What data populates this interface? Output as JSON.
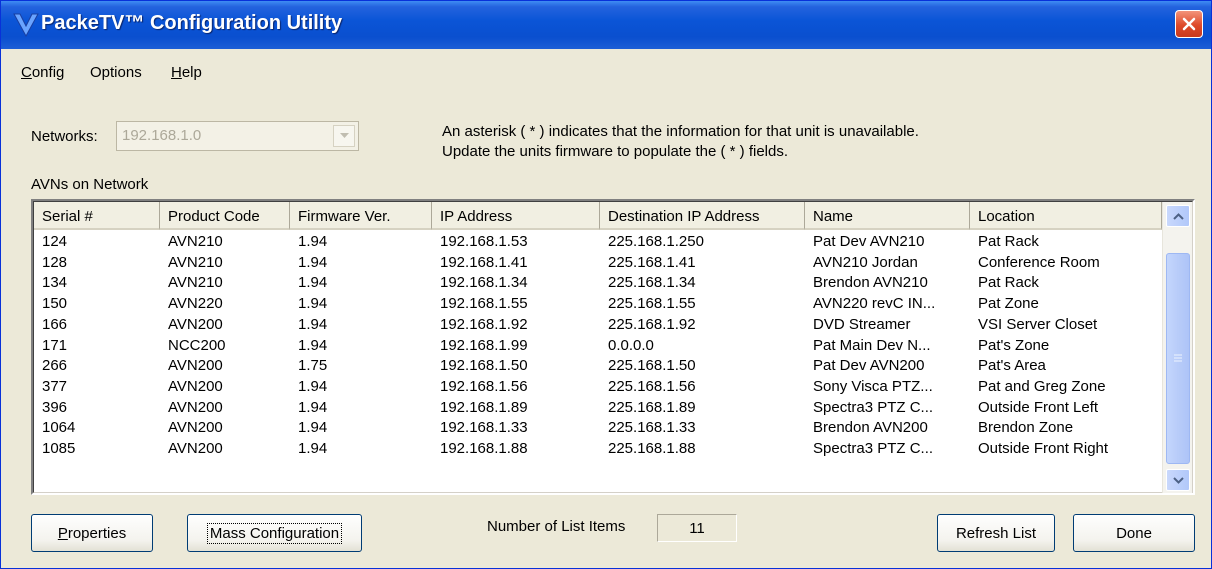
{
  "window": {
    "title": "PackeTV™ Configuration Utility"
  },
  "menu": [
    {
      "label": "Config",
      "accel": "C",
      "rest": "onfig"
    },
    {
      "label": "Options",
      "accel": "",
      "rest": "Options"
    },
    {
      "label": "Help",
      "accel": "H",
      "rest": "elp"
    }
  ],
  "networks": {
    "label": "Networks:",
    "value": "192.168.1.0"
  },
  "notice": {
    "line1": "An asterisk ( * ) indicates that the information for that unit is unavailable.",
    "line2": "Update the units firmware to populate the ( * ) fields."
  },
  "list": {
    "caption": "AVNs on Network",
    "columns": [
      "Serial #",
      "Product Code",
      "Firmware Ver.",
      "IP Address",
      "Destination IP Address",
      "Name",
      "Location"
    ],
    "rows": [
      [
        "124",
        "AVN210",
        "1.94",
        "192.168.1.53",
        "225.168.1.250",
        "Pat Dev AVN210",
        "Pat Rack"
      ],
      [
        "128",
        "AVN210",
        "1.94",
        "192.168.1.41",
        "225.168.1.41",
        "AVN210 Jordan",
        "Conference Room"
      ],
      [
        "134",
        "AVN210",
        "1.94",
        "192.168.1.34",
        "225.168.1.34",
        "Brendon AVN210",
        "Pat Rack"
      ],
      [
        "150",
        "AVN220",
        "1.94",
        "192.168.1.55",
        "225.168.1.55",
        "AVN220 revC IN...",
        "Pat Zone"
      ],
      [
        "166",
        "AVN200",
        "1.94",
        "192.168.1.92",
        "225.168.1.92",
        "DVD Streamer",
        "VSI Server Closet"
      ],
      [
        "171",
        "NCC200",
        "1.94",
        "192.168.1.99",
        "0.0.0.0",
        "Pat Main Dev N...",
        "Pat's Zone"
      ],
      [
        "266",
        "AVN200",
        "1.75",
        "192.168.1.50",
        "225.168.1.50",
        "Pat Dev AVN200",
        "Pat's Area"
      ],
      [
        "377",
        "AVN200",
        "1.94",
        "192.168.1.56",
        "225.168.1.56",
        "Sony Visca PTZ...",
        "Pat and Greg Zone"
      ],
      [
        "396",
        "AVN200",
        "1.94",
        "192.168.1.89",
        "225.168.1.89",
        "Spectra3 PTZ C...",
        "Outside Front Left"
      ],
      [
        "1064",
        "AVN200",
        "1.94",
        "192.168.1.33",
        "225.168.1.33",
        "Brendon AVN200",
        "Brendon Zone"
      ],
      [
        "1085",
        "AVN200",
        "1.94",
        "192.168.1.88",
        "225.168.1.88",
        "Spectra3 PTZ C...",
        "Outside Front Right"
      ]
    ]
  },
  "buttons": {
    "properties": {
      "label": "Properties",
      "accel": "P",
      "rest": "roperties"
    },
    "mass_config": "Mass Configuration",
    "refresh": "Refresh List",
    "done": "Done"
  },
  "count": {
    "label": "Number of List Items",
    "value": "11"
  },
  "icons": {
    "close": "close-icon",
    "logo": "packetv-logo-icon",
    "dropdown": "chevron-down-icon",
    "scroll_up": "scroll-up-icon",
    "scroll_down": "scroll-down-icon"
  },
  "colors": {
    "titlebar": "#0a4fcf",
    "close": "#de4a2a",
    "dialog": "#ece9d8"
  }
}
